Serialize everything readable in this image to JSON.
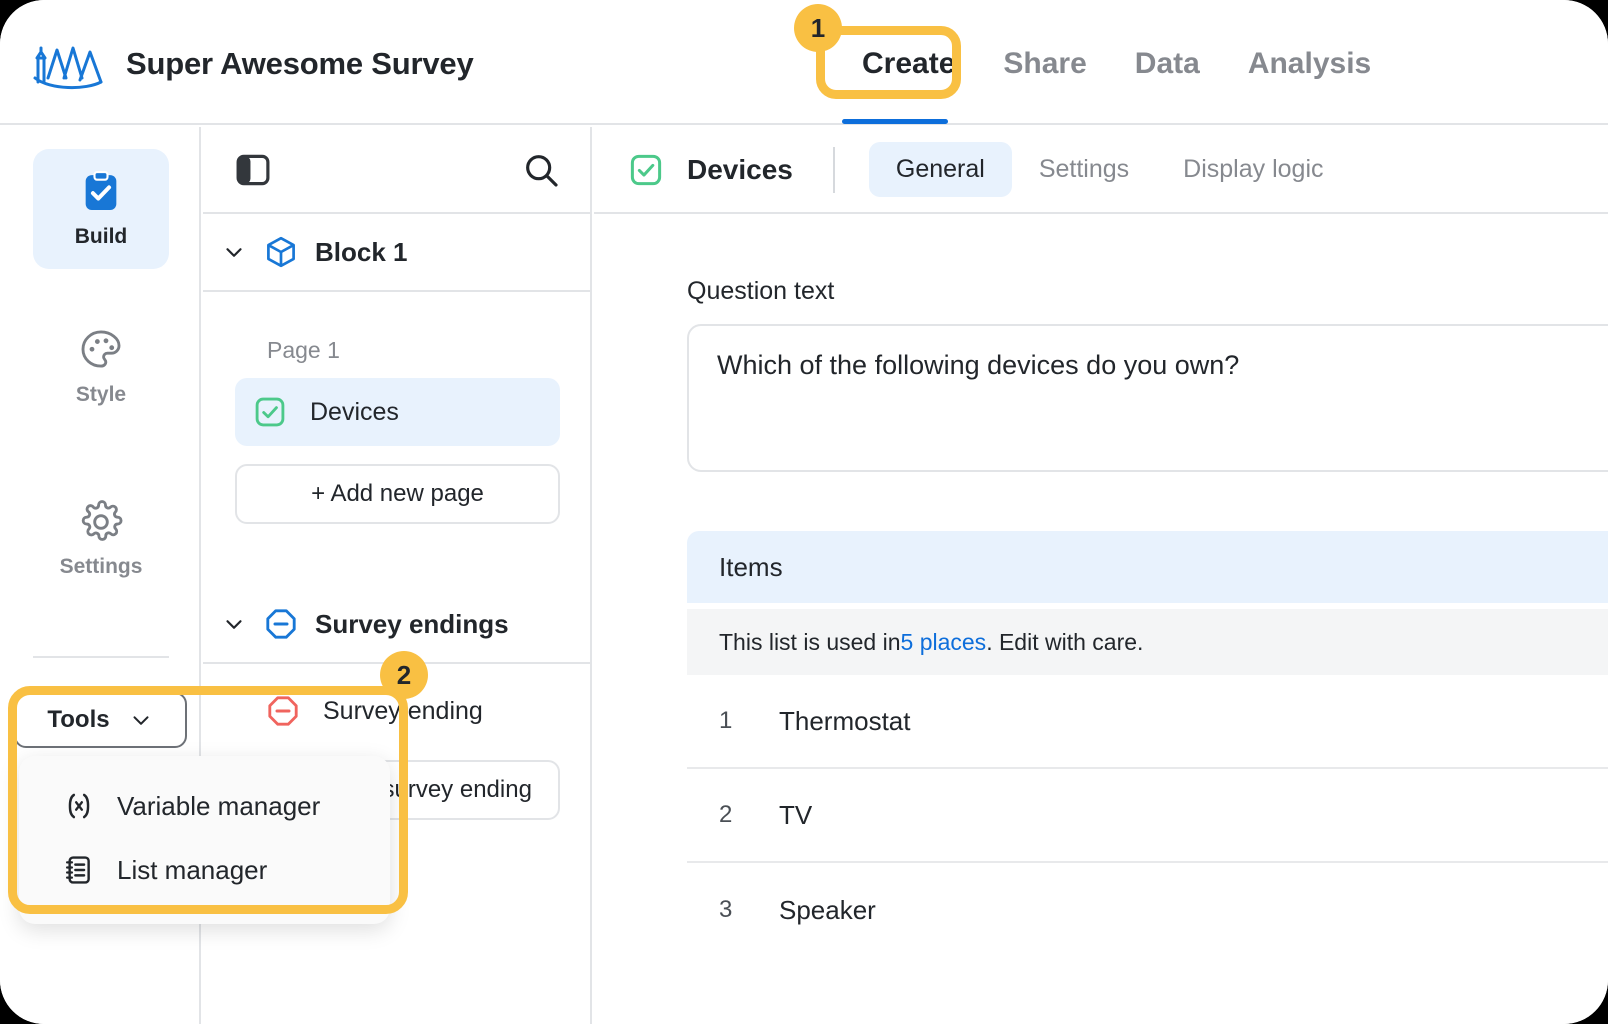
{
  "colors": {
    "accent_blue": "#0d6edb",
    "highlight_yellow": "#f9c043",
    "green_check": "#4cc98a",
    "red_stop": "#f0645e",
    "selected_bg": "#e8f2fd",
    "muted_text": "#86898f"
  },
  "topbar": {
    "logo_icon": "mountains-logo-icon",
    "title": "Super Awesome Survey",
    "tabs": [
      {
        "label": "Create",
        "active": true
      },
      {
        "label": "Share",
        "active": false
      },
      {
        "label": "Data",
        "active": false
      },
      {
        "label": "Analysis",
        "active": false
      }
    ]
  },
  "rail": {
    "items": [
      {
        "label": "Build",
        "icon": "clipboard-check-icon",
        "active": true
      },
      {
        "label": "Style",
        "icon": "palette-icon",
        "active": false
      },
      {
        "label": "Settings",
        "icon": "gear-icon",
        "active": false
      }
    ],
    "tools_button": {
      "label": "Tools",
      "chevron_icon": "chevron-down-icon",
      "expanded": true
    },
    "tools_menu": [
      {
        "label": "Variable manager",
        "icon": "variable-brackets-icon"
      },
      {
        "label": "List manager",
        "icon": "list-document-icon"
      }
    ]
  },
  "midpanel": {
    "header": {
      "panel_toggle_icon": "panel-toggle-icon",
      "search_icon": "search-icon"
    },
    "block": {
      "chevron_icon": "chevron-down-icon",
      "icon": "cube-icon",
      "title": "Block 1"
    },
    "page_label": "Page 1",
    "questions": [
      {
        "label": "Devices",
        "icon": "checkbox-check-icon",
        "selected": true
      }
    ],
    "add_page_label": "+ Add new page",
    "endings_section": {
      "chevron_icon": "chevron-down-icon",
      "icon": "stop-octagon-blue-icon",
      "title": "Survey endings"
    },
    "endings": [
      {
        "label": "Survey ending",
        "icon": "stop-octagon-red-icon"
      }
    ],
    "add_ending_label": "+ Add new survey ending"
  },
  "rightpanel": {
    "header": {
      "icon": "checkbox-check-icon",
      "title": "Devices",
      "tabs": [
        {
          "label": "General",
          "active": true
        },
        {
          "label": "Settings",
          "active": false
        },
        {
          "label": "Display logic",
          "active": false
        }
      ]
    },
    "question_text": {
      "label": "Question text",
      "value": "Which of the following devices do you own?"
    },
    "items_section": {
      "header": "Items",
      "note_prefix": "This list is used in ",
      "note_link": "5 places",
      "note_suffix": ". Edit with care.",
      "rows": [
        {
          "num": "1",
          "text": "Thermostat"
        },
        {
          "num": "2",
          "text": "TV"
        },
        {
          "num": "3",
          "text": "Speaker"
        }
      ]
    }
  },
  "annotations": [
    {
      "number": "1",
      "target": "create-tab"
    },
    {
      "number": "2",
      "target": "tools-menu"
    }
  ]
}
